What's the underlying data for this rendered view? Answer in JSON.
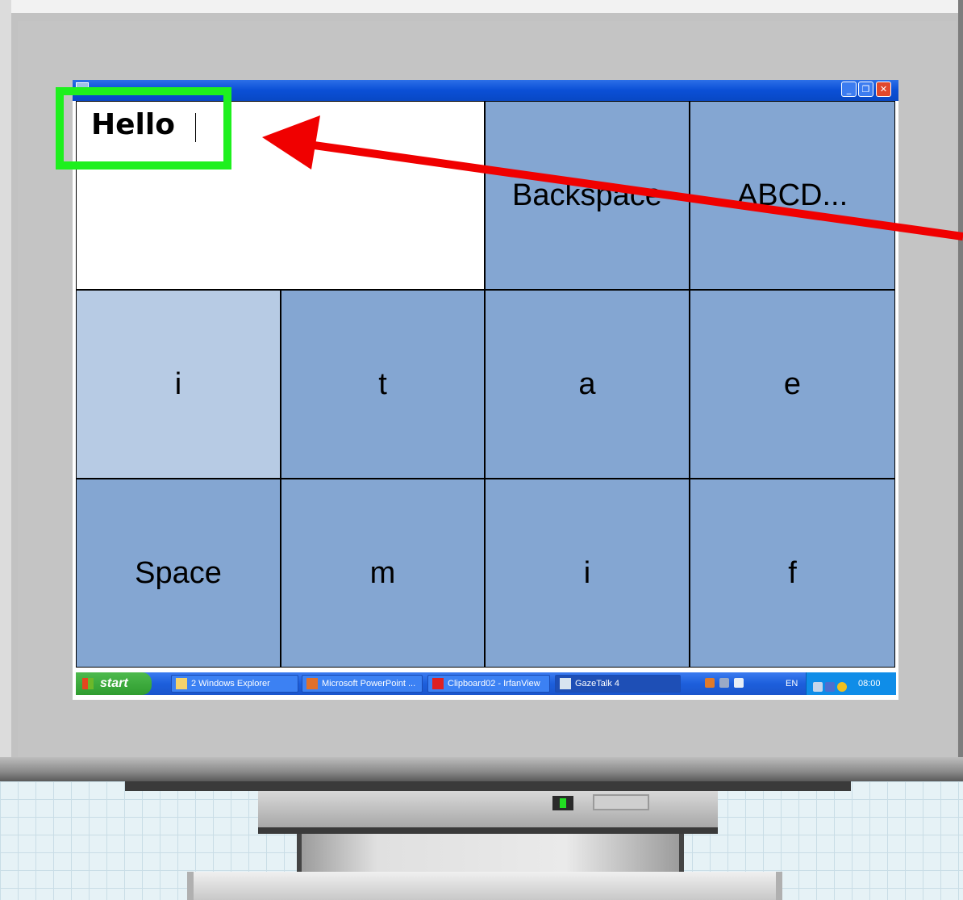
{
  "window": {
    "title": "",
    "min_label": "_",
    "max_label": "❐",
    "close_label": "✕"
  },
  "editor": {
    "typed_text": "Hello"
  },
  "keys": [
    {
      "label": "Backspace"
    },
    {
      "label": "ABCD..."
    },
    {
      "label": "i"
    },
    {
      "label": "t"
    },
    {
      "label": "a"
    },
    {
      "label": "e"
    },
    {
      "label": "Space"
    },
    {
      "label": "m"
    },
    {
      "label": "i"
    },
    {
      "label": "f"
    }
  ],
  "taskbar": {
    "start_label": "start",
    "tasks": [
      {
        "label": "2 Windows Explorer",
        "icon": "folder-icon"
      },
      {
        "label": "Microsoft PowerPoint ...",
        "icon": "powerpoint-icon"
      },
      {
        "label": "Clipboard02 - IrfanView",
        "icon": "irfanview-icon"
      },
      {
        "label": "GazeTalk 4",
        "icon": "gazetalk-icon"
      }
    ],
    "language": "EN",
    "clock": "08:00"
  },
  "colors": {
    "key_blue": "#84a6d2",
    "key_highlight": "#b7cbe4",
    "annotation_green": "#1ef01e",
    "annotation_red": "#f00000"
  }
}
